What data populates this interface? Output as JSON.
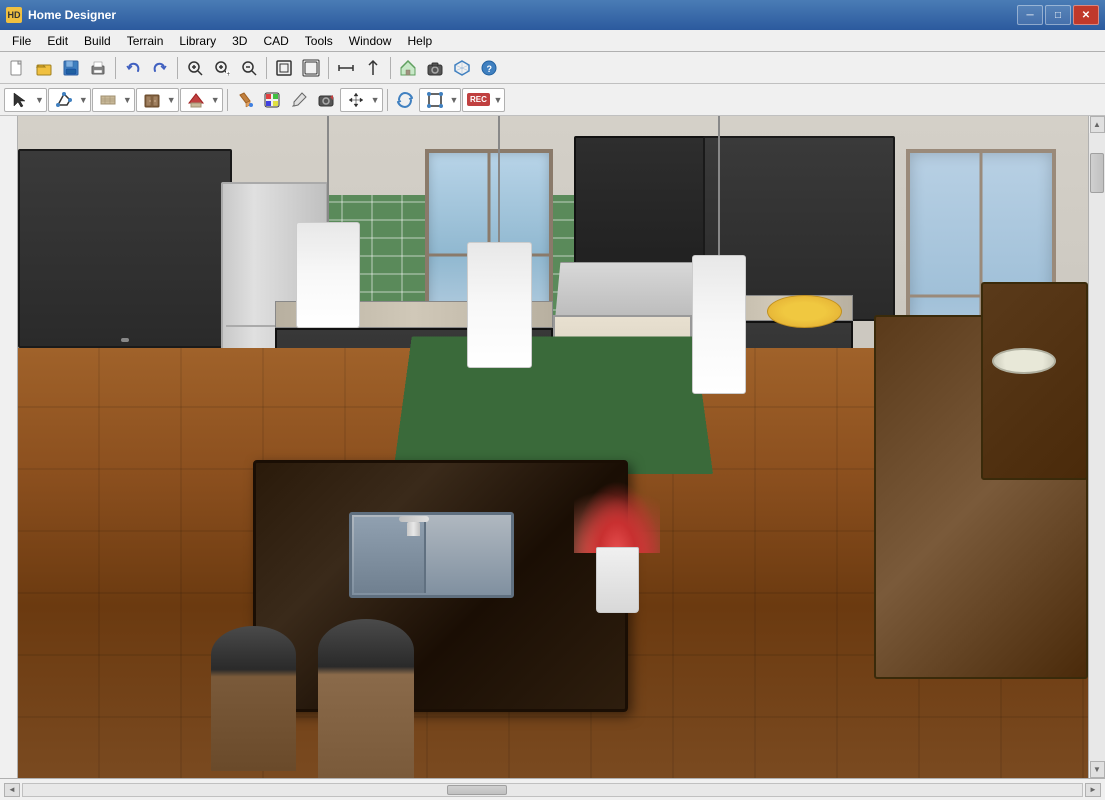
{
  "app": {
    "title": "Home Designer",
    "icon": "HD"
  },
  "window_controls": {
    "minimize": "─",
    "maximize": "□",
    "close": "✕"
  },
  "menu": {
    "items": [
      "File",
      "Edit",
      "Build",
      "Terrain",
      "Library",
      "3D",
      "CAD",
      "Tools",
      "Window",
      "Help"
    ]
  },
  "toolbar1": {
    "buttons": [
      "new",
      "open",
      "save",
      "print",
      "undo",
      "redo",
      "zoom-in-rect",
      "zoom-in",
      "zoom-out",
      "fit-page",
      "fit-page2",
      "zoom-window",
      "sep",
      "draw-line",
      "arrow-up",
      "arrow-vert",
      "sep",
      "house-icon",
      "camera",
      "perspective"
    ]
  },
  "toolbar2": {
    "buttons": [
      "select",
      "draw-poly",
      "wall-tool",
      "cabinet-tool",
      "roof-tool",
      "exterior",
      "sep",
      "paint-bucket",
      "material",
      "eyedrop",
      "camera2",
      "select2",
      "sep",
      "arrow-up2",
      "transform",
      "record"
    ]
  },
  "scene": {
    "type": "3D Kitchen Render",
    "description": "Interior 3D view of a modern kitchen with island, pendant lights, dark cabinets, green tile backsplash"
  },
  "status_bar": {
    "text": ""
  }
}
